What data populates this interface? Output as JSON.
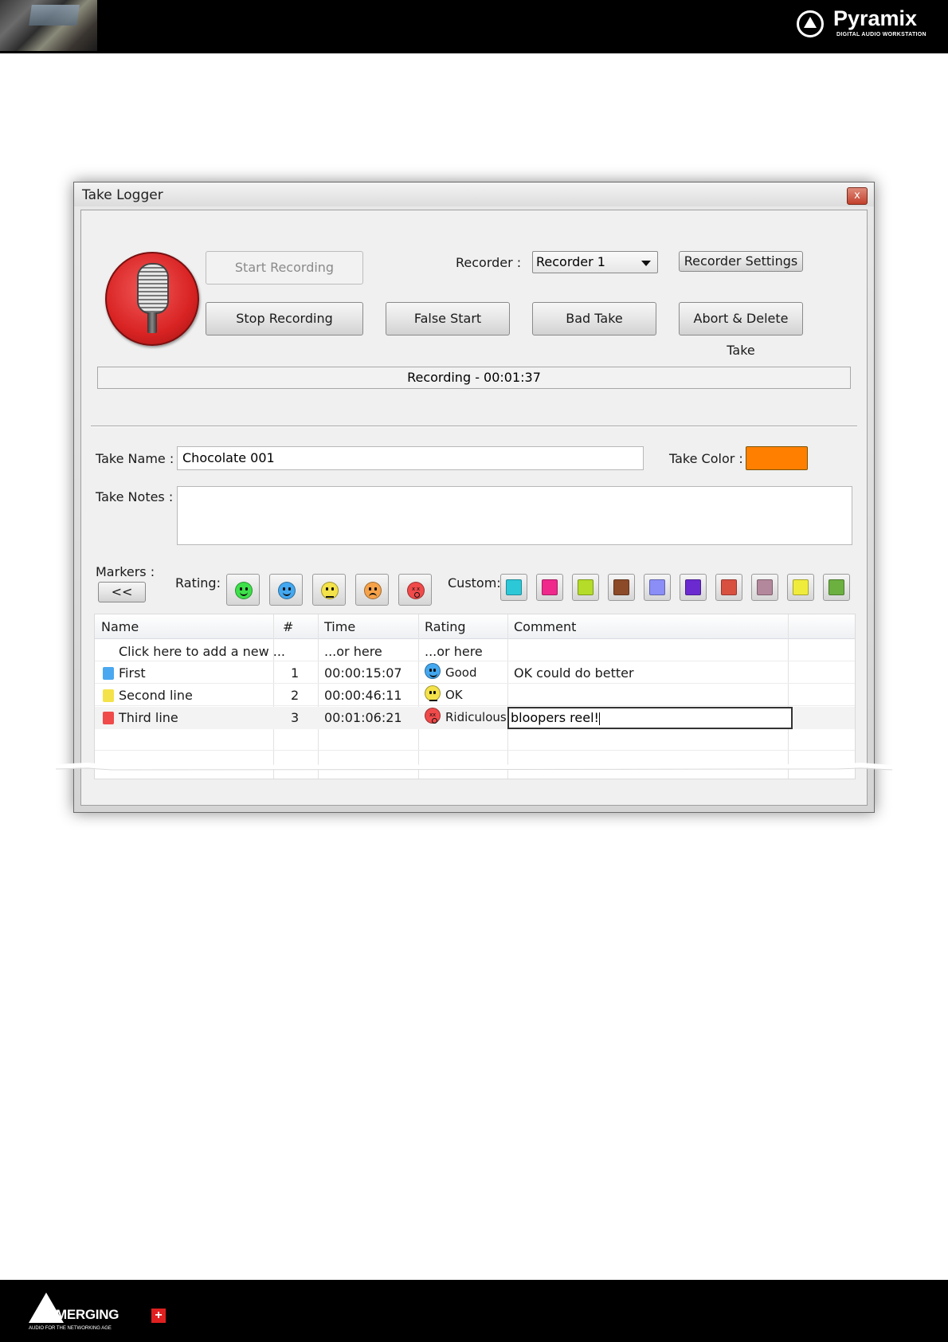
{
  "header": {
    "brand": "Pyramix",
    "brand_sub": "DIGITAL AUDIO WORKSTATION"
  },
  "footer": {
    "brand": "MERGING",
    "brand_plus": "+",
    "brand_sub": "AUDIO FOR THE NETWORKING AGE"
  },
  "window": {
    "title": "Take Logger",
    "close": "x"
  },
  "recording": {
    "start_label": "Start Recording",
    "stop_label": "Stop Recording",
    "false_start_label": "False Start",
    "bad_take_label": "Bad Take",
    "abort_label": "Abort & Delete Take",
    "recorder_label": "Recorder :",
    "recorder_value": "Recorder 1",
    "settings_label": "Recorder Settings",
    "status": "Recording - 00:01:37"
  },
  "take": {
    "name_label": "Take Name :",
    "name_value": "Chocolate 001",
    "color_label": "Take Color :",
    "color": "#ff8000",
    "notes_label": "Take Notes :",
    "notes_value": ""
  },
  "markers": {
    "label": "Markers :",
    "back_label": "<<",
    "rating_label": "Rating:",
    "ratings": [
      {
        "icon": "very-happy-face-icon",
        "color": "#3ee04a",
        "mood": "smile"
      },
      {
        "icon": "happy-face-icon",
        "color": "#43a8f0",
        "mood": "smile"
      },
      {
        "icon": "neutral-face-icon",
        "color": "#f4e24a",
        "mood": "flat"
      },
      {
        "icon": "sad-face-icon",
        "color": "#f6a24a",
        "mood": "sad"
      },
      {
        "icon": "dead-face-icon",
        "color": "#f04a4a",
        "mood": "dead"
      }
    ],
    "custom_label": "Custom:",
    "custom_colors": [
      "#2cc8d8",
      "#f0288c",
      "#b4dc28",
      "#8c4a28",
      "#8a8ef6",
      "#6a2ad0",
      "#d85040",
      "#b4889c",
      "#f0ec3c",
      "#6cb040"
    ]
  },
  "table": {
    "columns": [
      "Name",
      "#",
      "Time",
      "Rating",
      "Comment"
    ],
    "add_row": {
      "name": "Click here to add a new ...",
      "time": "...or here",
      "rating": "...or here"
    },
    "rows": [
      {
        "color": "#4aa8f0",
        "name": "First",
        "num": "1",
        "time": "00:00:15:07",
        "rating_icon": "happy-face-icon",
        "rating_color": "#43a8f0",
        "rating_mood": "smile",
        "rating": "Good",
        "comment": "OK could do better"
      },
      {
        "color": "#f4e24a",
        "name": "Second line",
        "num": "2",
        "time": "00:00:46:11",
        "rating_icon": "neutral-face-icon",
        "rating_color": "#f4e24a",
        "rating_mood": "flat",
        "rating": "OK",
        "comment": ""
      },
      {
        "color": "#f04a4a",
        "name": "Third line",
        "num": "3",
        "time": "00:01:06:21",
        "rating_icon": "dead-face-icon",
        "rating_color": "#f04a4a",
        "rating_mood": "dead",
        "rating": "Ridiculous",
        "comment": "bloopers reel!"
      }
    ]
  }
}
